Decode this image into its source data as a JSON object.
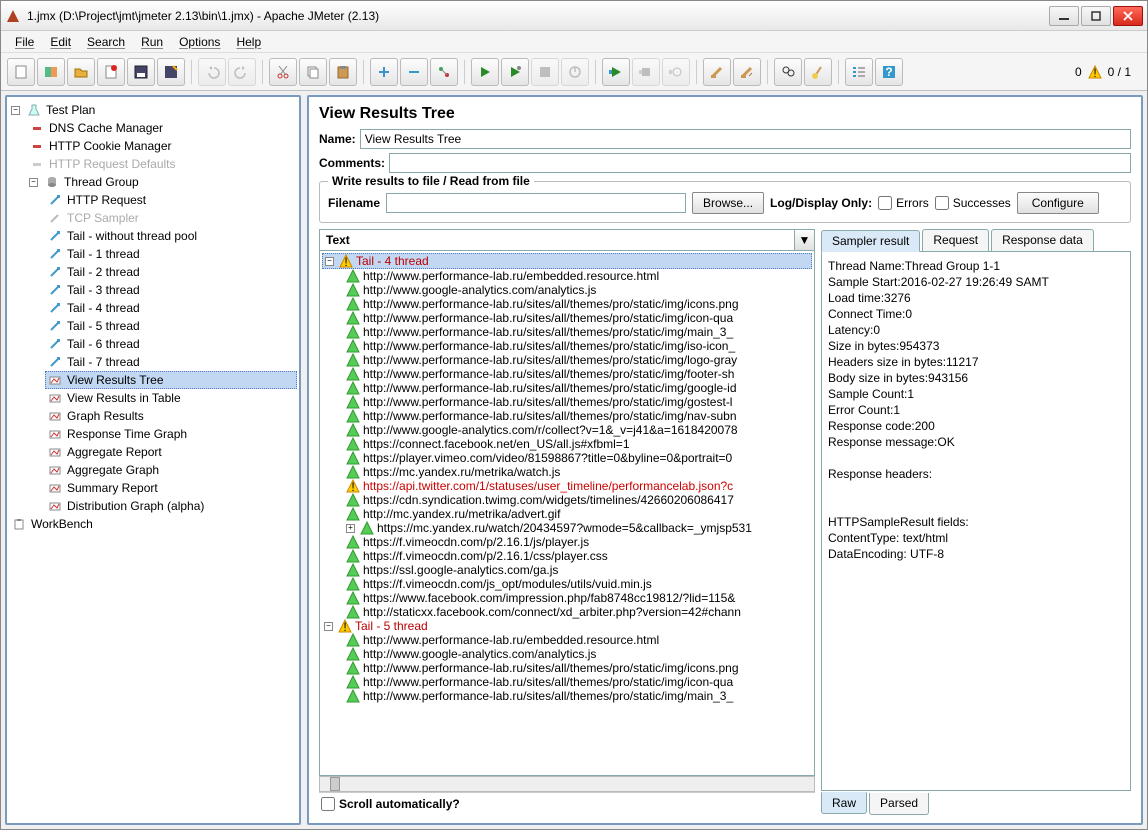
{
  "title": "1.jmx (D:\\Project\\jmt\\jmeter 2.13\\bin\\1.jmx) - Apache JMeter (2.13)",
  "menu": [
    "File",
    "Edit",
    "Search",
    "Run",
    "Options",
    "Help"
  ],
  "toolbar_status": {
    "left_count": "0",
    "right_ratio": "0 / 1"
  },
  "tree": {
    "root": "Test Plan",
    "dns": "DNS Cache Manager",
    "cookie": "HTTP Cookie Manager",
    "defaults": "HTTP Request Defaults",
    "tg": "Thread Group",
    "httpreq": "HTTP Request",
    "tcp": "TCP Sampler",
    "tails": [
      "Tail - without thread pool",
      "Tail - 1 thread",
      "Tail - 2 thread",
      "Tail - 3 thread",
      "Tail - 4 thread",
      "Tail - 5 thread",
      "Tail - 6 thread",
      "Tail - 7 thread"
    ],
    "listeners": [
      "View Results Tree",
      "View Results in Table",
      "Graph Results",
      "Response Time Graph",
      "Aggregate Report",
      "Aggregate Graph",
      "Summary Report",
      "Distribution Graph (alpha)"
    ],
    "workbench": "WorkBench"
  },
  "detail": {
    "heading": "View Results Tree",
    "name_label": "Name:",
    "name_value": "View Results Tree",
    "comments_label": "Comments:",
    "fieldset_legend": "Write results to file / Read from file",
    "filename_label": "Filename",
    "browse_btn": "Browse...",
    "logdisplay": "Log/Display Only:",
    "errors": "Errors",
    "successes": "Successes",
    "configure": "Configure",
    "combo": "Text",
    "scroll_auto": "Scroll automatically?"
  },
  "results": {
    "group1": "Tail - 4 thread",
    "group1_items": [
      "http://www.performance-lab.ru/embedded.resource.html",
      "http://www.google-analytics.com/analytics.js",
      "http://www.performance-lab.ru/sites/all/themes/pro/static/img/icons.png",
      "http://www.performance-lab.ru/sites/all/themes/pro/static/img/icon-qua",
      "http://www.performance-lab.ru/sites/all/themes/pro/static/img/main_3_",
      "http://www.performance-lab.ru/sites/all/themes/pro/static/img/iso-icon_",
      "http://www.performance-lab.ru/sites/all/themes/pro/static/img/logo-gray",
      "http://www.performance-lab.ru/sites/all/themes/pro/static/img/footer-sh",
      "http://www.performance-lab.ru/sites/all/themes/pro/static/img/google-id",
      "http://www.performance-lab.ru/sites/all/themes/pro/static/img/gostest-l",
      "http://www.performance-lab.ru/sites/all/themes/pro/static/img/nav-subn",
      "http://www.google-analytics.com/r/collect?v=1&_v=j41&a=1618420078",
      "https://connect.facebook.net/en_US/all.js#xfbml=1",
      "https://player.vimeo.com/video/81598867?title=0&byline=0&portrait=0",
      "https://mc.yandex.ru/metrika/watch.js"
    ],
    "group1_error": "https://api.twitter.com/1/statuses/user_timeline/performancelab.json?c",
    "group1_items2": [
      "https://cdn.syndication.twimg.com/widgets/timelines/42660206086417",
      "http://mc.yandex.ru/metrika/advert.gif",
      "https://mc.yandex.ru/watch/20434597?wmode=5&callback=_ymjsp531",
      "https://f.vimeocdn.com/p/2.16.1/js/player.js",
      "https://f.vimeocdn.com/p/2.16.1/css/player.css",
      "https://ssl.google-analytics.com/ga.js",
      "https://f.vimeocdn.com/js_opt/modules/utils/vuid.min.js",
      "https://www.facebook.com/impression.php/fab8748cc19812/?lid=115&",
      "http://staticxx.facebook.com/connect/xd_arbiter.php?version=42#chann"
    ],
    "group2": "Tail - 5 thread",
    "group2_items": [
      "http://www.performance-lab.ru/embedded.resource.html",
      "http://www.google-analytics.com/analytics.js",
      "http://www.performance-lab.ru/sites/all/themes/pro/static/img/icons.png",
      "http://www.performance-lab.ru/sites/all/themes/pro/static/img/icon-qua",
      "http://www.performance-lab.ru/sites/all/themes/pro/static/img/main_3_"
    ]
  },
  "tabs": {
    "t1": "Sampler result",
    "t2": "Request",
    "t3": "Response data",
    "raw": "Raw",
    "parsed": "Parsed"
  },
  "sampler": {
    "lines": [
      "Thread Name:Thread Group 1-1",
      "Sample Start:2016-02-27 19:26:49 SAMT",
      "Load time:3276",
      "Connect Time:0",
      "Latency:0",
      "Size in bytes:954373",
      "Headers size in bytes:11217",
      "Body size in bytes:943156",
      "Sample Count:1",
      "Error Count:1",
      "Response code:200",
      "Response message:OK",
      "",
      "Response headers:",
      "",
      "",
      "HTTPSampleResult fields:",
      "ContentType: text/html",
      "DataEncoding: UTF-8"
    ]
  }
}
